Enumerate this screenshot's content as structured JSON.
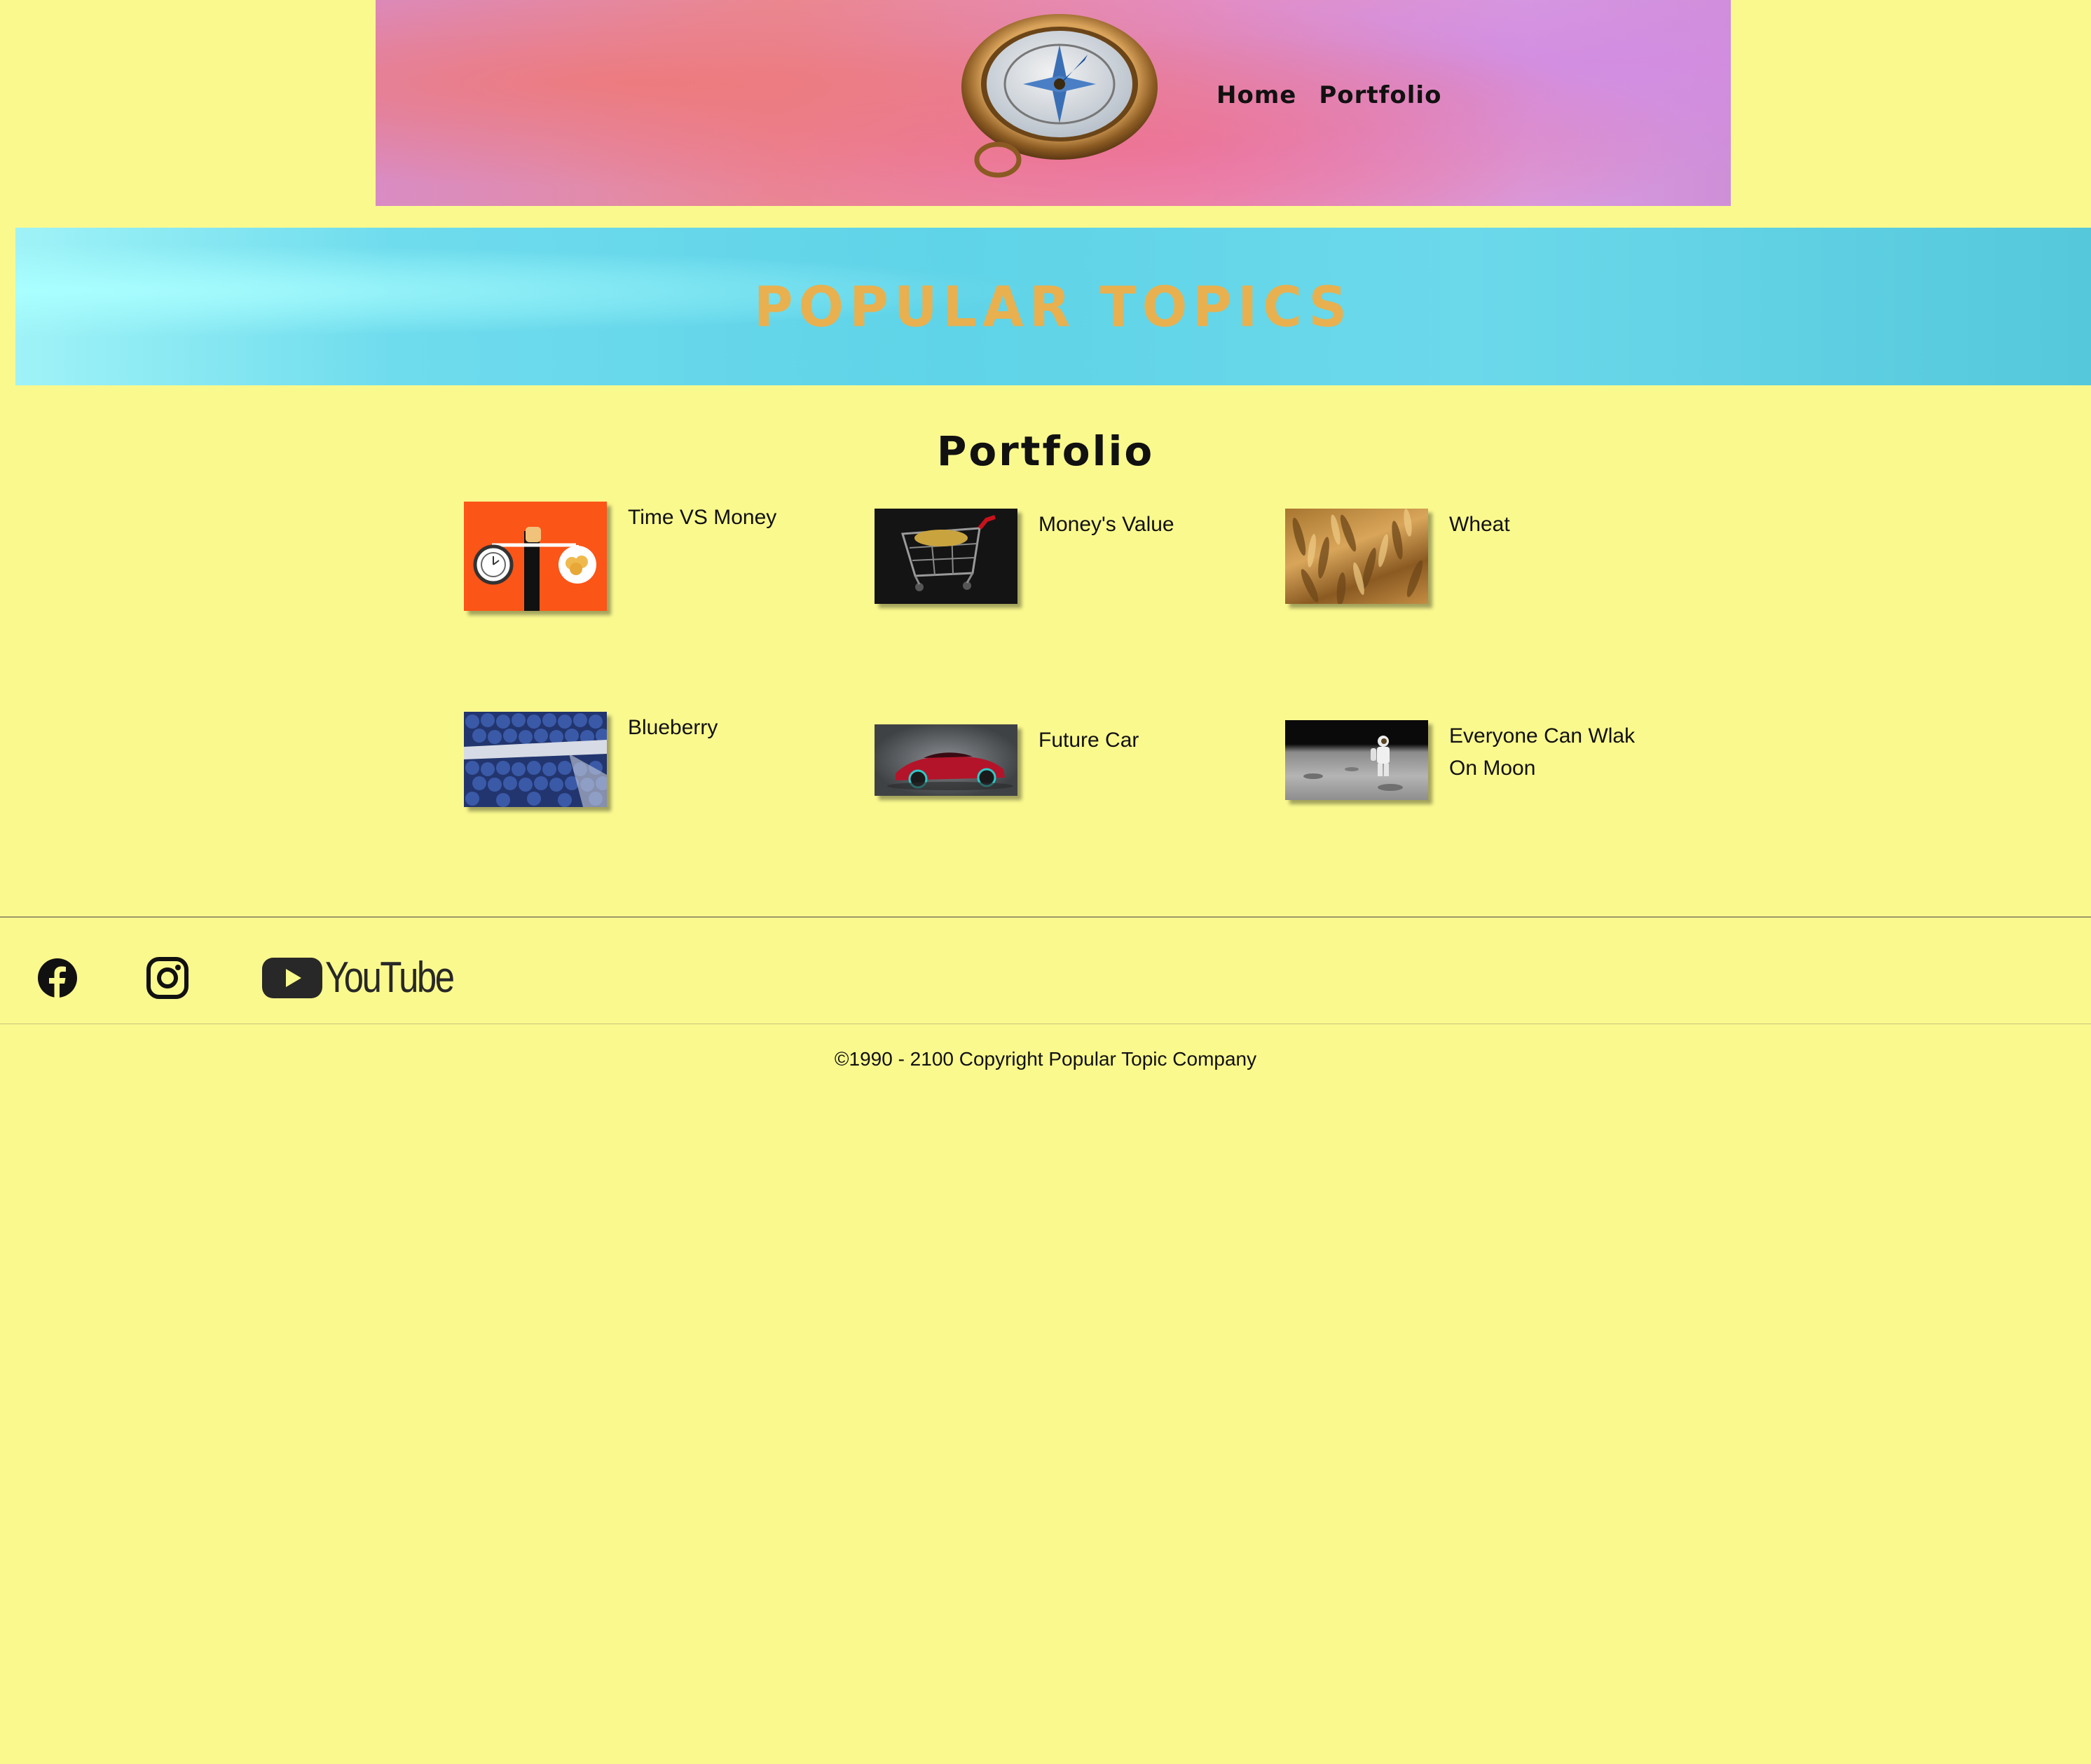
{
  "header": {
    "nav": [
      {
        "label": "Home"
      },
      {
        "label": "Portfolio"
      }
    ],
    "logo_icon": "compass-icon"
  },
  "banner": {
    "title": "POPULAR TOPICS"
  },
  "portfolio": {
    "title": "Portfolio",
    "items": [
      {
        "label": "Time VS Money",
        "icon": "time-vs-money-image"
      },
      {
        "label": "Money's Value",
        "icon": "shopping-cart-image"
      },
      {
        "label": "Wheat",
        "icon": "wheat-image"
      },
      {
        "label": "Blueberry",
        "icon": "blueberry-image"
      },
      {
        "label": "Future Car",
        "icon": "future-car-image"
      },
      {
        "label": "Everyone Can Wlak On Moon",
        "icon": "moon-astronaut-image"
      }
    ]
  },
  "footer": {
    "social": [
      {
        "name": "facebook",
        "icon": "facebook-icon"
      },
      {
        "name": "instagram",
        "icon": "instagram-icon"
      },
      {
        "name": "youtube",
        "icon": "youtube-icon",
        "label": "YouTube"
      }
    ],
    "copyright": "©1990 - 2100 Copyright Popular Topic Company"
  },
  "colors": {
    "page_background": "#faf98e",
    "banner_title": "#e8b04f",
    "banner_background": "#5fd3e8",
    "time_money_background": "#fb5517"
  }
}
